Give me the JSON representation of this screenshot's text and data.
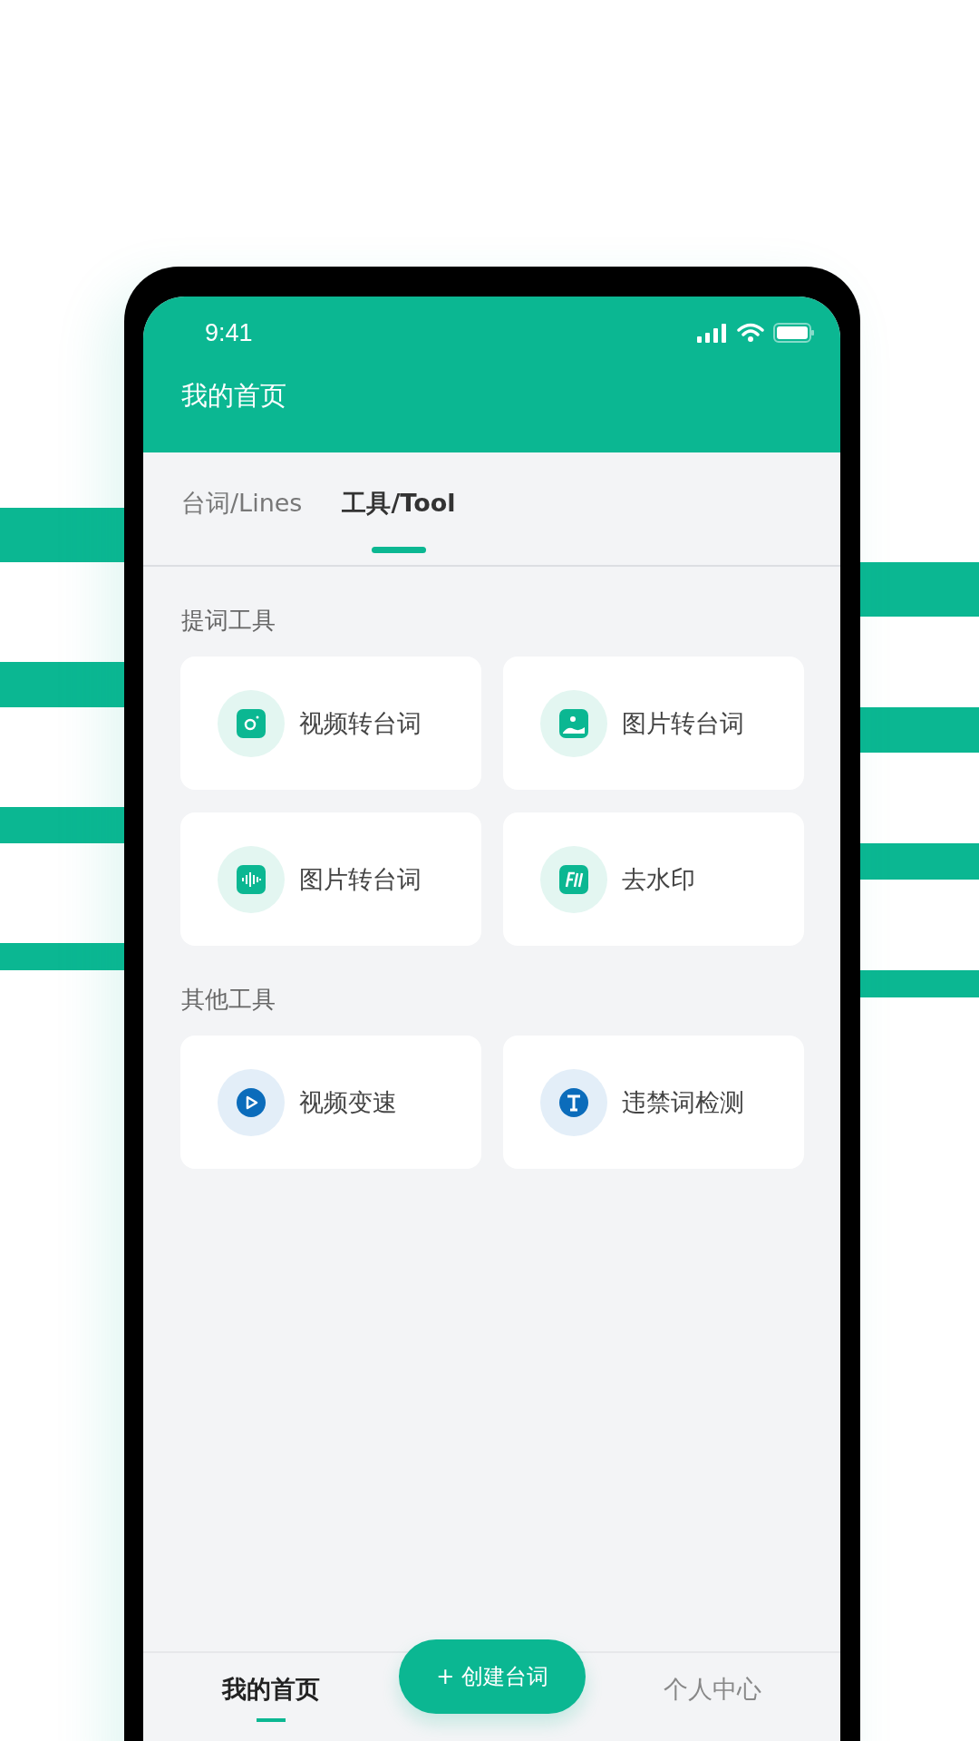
{
  "status_bar": {
    "time": "9:41"
  },
  "header": {
    "title": "我的首页"
  },
  "tabs": [
    {
      "label": "台词/Lines",
      "selected": false
    },
    {
      "label": "工具/Tool",
      "selected": true
    }
  ],
  "sections": [
    {
      "title": "提词工具",
      "tools": [
        {
          "label": "视频转台词",
          "kind": "camera",
          "color": "#0bb792"
        },
        {
          "label": "图片转台词",
          "kind": "image",
          "color": "#0bb792"
        },
        {
          "label": "图片转台词",
          "kind": "audio",
          "color": "#0bb792"
        },
        {
          "label": "去水印",
          "kind": "watermark",
          "color": "#0bb792"
        }
      ]
    },
    {
      "title": "其他工具",
      "tools": [
        {
          "label": "视频变速",
          "kind": "play",
          "color": "#0b6cbb"
        },
        {
          "label": "违禁词检测",
          "kind": "text",
          "color": "#0b6cbb"
        }
      ]
    }
  ],
  "fab": {
    "label": "+ 创建台词"
  },
  "bottom_nav": [
    {
      "label": "我的首页",
      "selected": true
    },
    {
      "label": "个人中心",
      "selected": false
    }
  ]
}
